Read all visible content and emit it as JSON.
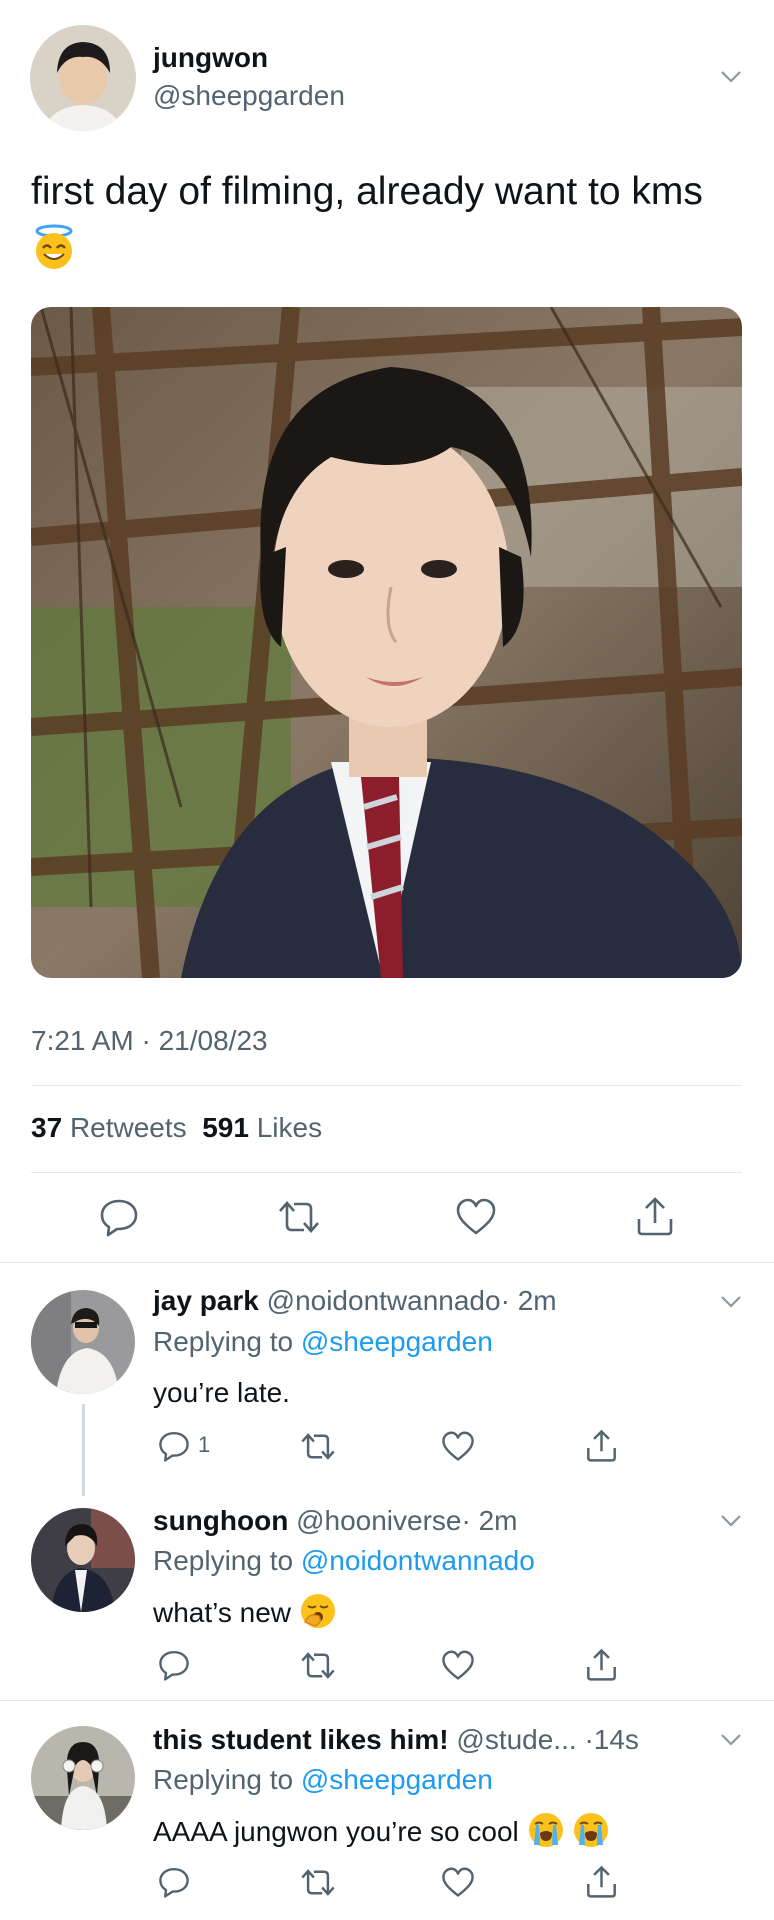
{
  "tweet": {
    "name": "jungwon",
    "handle": "@sheepgarden",
    "text": "first day of filming, already want to kms",
    "emoji_icon": "smiling-face-with-halo-icon",
    "timestamp": "7:21 AM · 21/08/23",
    "retweets_count": "37",
    "retweets_label": "Retweets",
    "likes_count": "591",
    "likes_label": "Likes",
    "image_icon": "selfie-photo"
  },
  "colors": {
    "text": "#0f1419",
    "muted": "#536471",
    "link": "#1d9bf0",
    "divider": "#e6e9ec"
  },
  "actions": {
    "reply_icon": "reply-icon",
    "retweet_icon": "retweet-icon",
    "like_icon": "heart-icon",
    "share_icon": "share-icon"
  },
  "replies": [
    {
      "name": "jay park",
      "handle": "@noidontwannado",
      "time": "· 2m",
      "replying_label": "Replying to",
      "replying_to": "@sheepgarden",
      "text": "you’re late.",
      "reply_count": "1"
    },
    {
      "name": "sunghoon",
      "handle": "@hooniverse",
      "time": "· 2m",
      "replying_label": "Replying to",
      "replying_to": "@noidontwannado",
      "text": "what’s new",
      "emoji_icon": "yawning-face-icon"
    },
    {
      "name": "this student likes him!",
      "handle": "@stude...",
      "time": "·14s",
      "replying_label": "Replying to",
      "replying_to": "@sheepgarden",
      "text": "AAAA jungwon you’re so cool",
      "emoji_icon": "loudly-crying-face-icon"
    }
  ]
}
